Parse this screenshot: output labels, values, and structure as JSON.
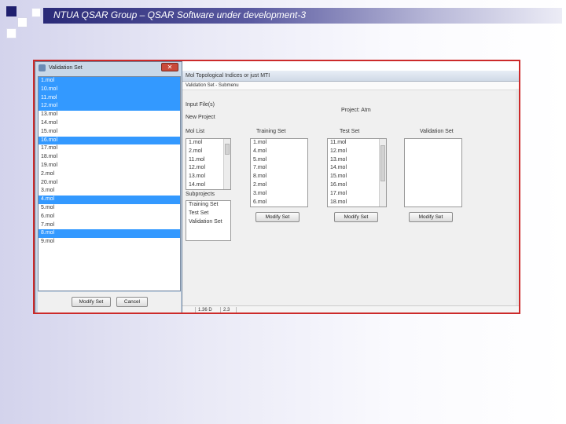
{
  "slide": {
    "title": "NTUA QSAR Group – QSAR Software under development-3"
  },
  "main_window": {
    "title": "Mol Topological Indices or just MTI",
    "menu": "Validation Set - Submenu",
    "input_file_label": "Input File(s)",
    "new_project_label": "New Project",
    "project_name": "Project: Atm",
    "mol_list_label": "Mol List",
    "mol_list": [
      "1.mol",
      "2.mol",
      "11.mol",
      "12.mol",
      "13.mol",
      "14.mol"
    ],
    "subprojects_label": "Subprojects",
    "subprojects": [
      "Training Set",
      "Test Set",
      "Validation Set"
    ],
    "training_set_label": "Training Set",
    "training_set": [
      "1.mol",
      "4.mol",
      "5.mol",
      "7.mol",
      "8.mol",
      "2.mol",
      "3.mol",
      "6.mol"
    ],
    "training_button": "Modify Set",
    "test_set_label": "Test Set",
    "test_set": [
      "11.mol",
      "12.mol",
      "13.mol",
      "14.mol",
      "15.mol",
      "16.mol",
      "17.mol",
      "18.mol"
    ],
    "test_button": "Modify Set",
    "validation_set_label": "Validation Set",
    "validation_button": "Modify Set",
    "status": [
      "",
      "1.36 D",
      "2.3"
    ]
  },
  "dialog": {
    "title": "Validation Set",
    "close": "✕",
    "items": [
      {
        "label": "1.mol",
        "selected": true
      },
      {
        "label": "10.mol",
        "selected": true
      },
      {
        "label": "11.mol",
        "selected": true
      },
      {
        "label": "12.mol",
        "selected": true
      },
      {
        "label": "13.mol",
        "selected": false
      },
      {
        "label": "14.mol",
        "selected": false
      },
      {
        "label": "15.mol",
        "selected": false
      },
      {
        "label": "16.mol",
        "selected": true
      },
      {
        "label": "17.mol",
        "selected": false
      },
      {
        "label": "18.mol",
        "selected": false
      },
      {
        "label": "19.mol",
        "selected": false
      },
      {
        "label": "2.mol",
        "selected": false
      },
      {
        "label": "20.mol",
        "selected": false
      },
      {
        "label": "3.mol",
        "selected": false
      },
      {
        "label": "4.mol",
        "selected": true
      },
      {
        "label": "5.mol",
        "selected": false
      },
      {
        "label": "6.mol",
        "selected": false
      },
      {
        "label": "7.mol",
        "selected": false
      },
      {
        "label": "8.mol",
        "selected": true
      },
      {
        "label": "9.mol",
        "selected": false
      }
    ],
    "modify_button": "Modify Set",
    "cancel_button": "Cancel"
  }
}
